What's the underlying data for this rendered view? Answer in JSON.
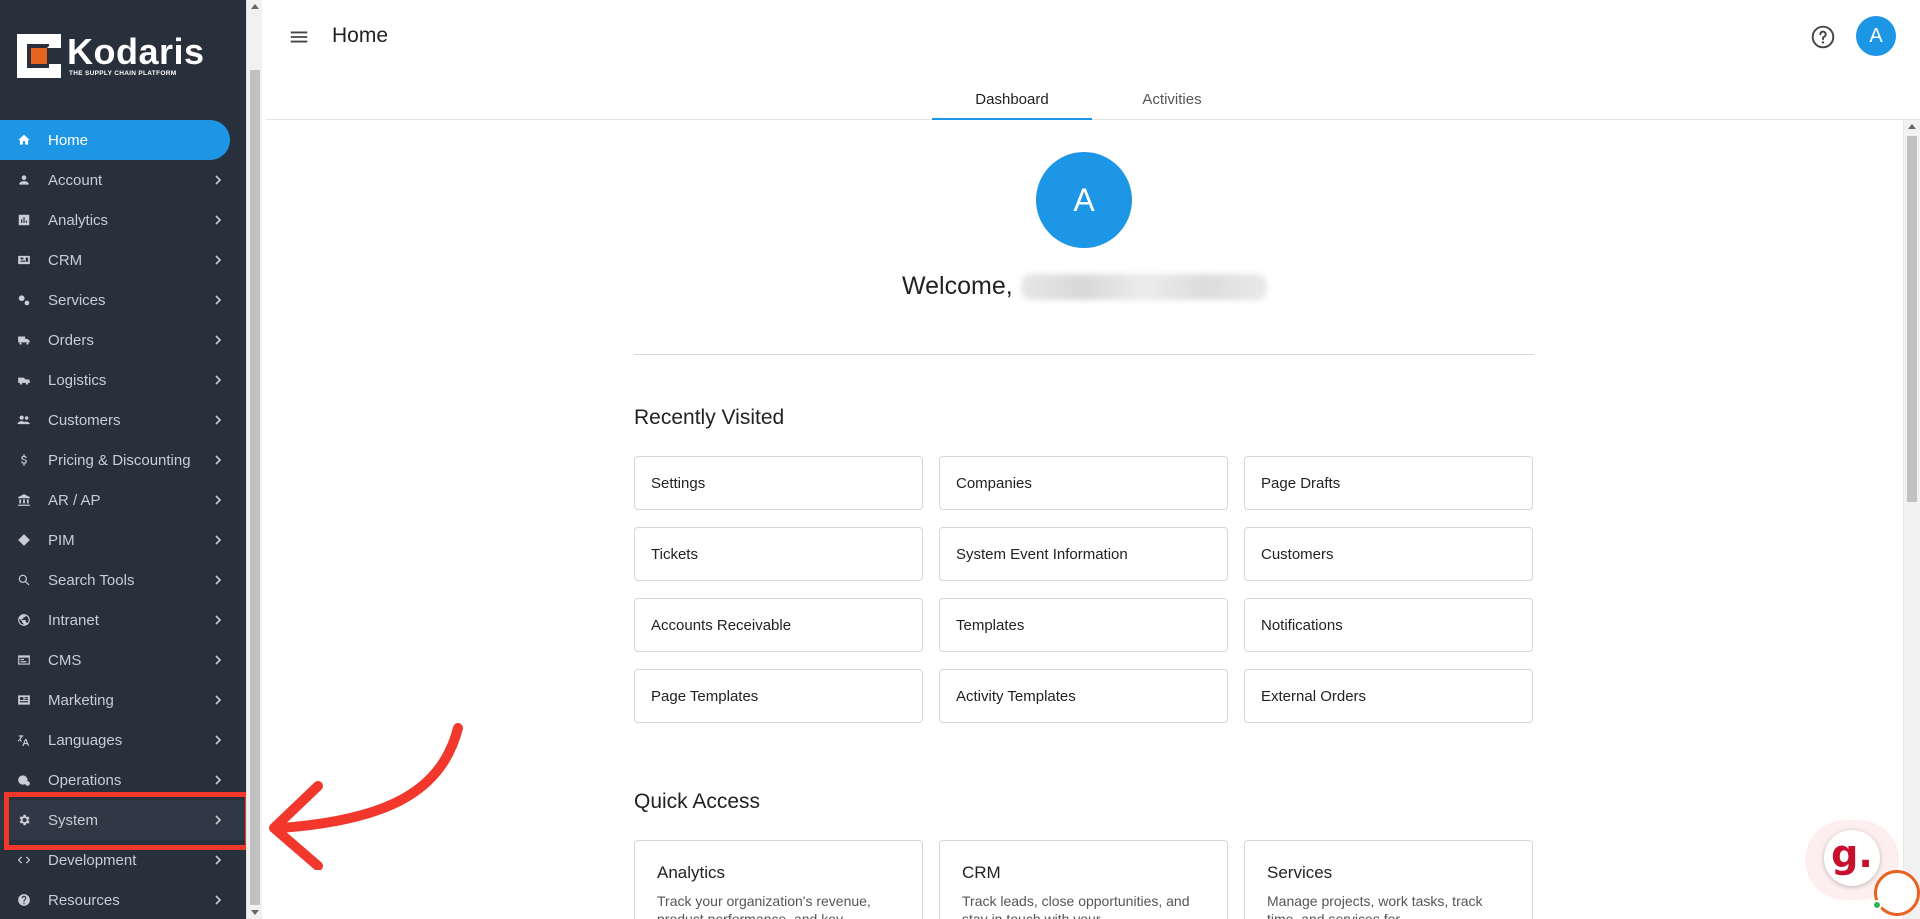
{
  "app": {
    "logo_name": "Kodaris",
    "logo_tagline": "THE SUPPLY CHAIN PLATFORM"
  },
  "sidebar": {
    "items": [
      {
        "label": "Home",
        "icon": "home-icon",
        "active": true
      },
      {
        "label": "Account",
        "icon": "person-icon"
      },
      {
        "label": "Analytics",
        "icon": "analytics-icon"
      },
      {
        "label": "CRM",
        "icon": "crm-icon"
      },
      {
        "label": "Services",
        "icon": "gears-icon"
      },
      {
        "label": "Orders",
        "icon": "truck-icon"
      },
      {
        "label": "Logistics",
        "icon": "shipping-icon"
      },
      {
        "label": "Customers",
        "icon": "people-icon"
      },
      {
        "label": "Pricing & Discounting",
        "icon": "dollar-icon"
      },
      {
        "label": "AR / AP",
        "icon": "bank-icon"
      },
      {
        "label": "PIM",
        "icon": "tag-icon"
      },
      {
        "label": "Search Tools",
        "icon": "search-icon"
      },
      {
        "label": "Intranet",
        "icon": "globe-icon"
      },
      {
        "label": "CMS",
        "icon": "cms-icon"
      },
      {
        "label": "Marketing",
        "icon": "newspaper-icon"
      },
      {
        "label": "Languages",
        "icon": "translate-icon"
      },
      {
        "label": "Operations",
        "icon": "operations-icon"
      },
      {
        "label": "System",
        "icon": "gear-icon",
        "highlighted": true
      },
      {
        "label": "Development",
        "icon": "code-icon"
      },
      {
        "label": "Resources",
        "icon": "help-circle-icon"
      }
    ]
  },
  "header": {
    "title": "Home",
    "avatar_letter": "A",
    "tabs": [
      {
        "label": "Dashboard",
        "active": true
      },
      {
        "label": "Activities",
        "active": false
      }
    ]
  },
  "main": {
    "avatar_letter": "A",
    "welcome": "Welcome,",
    "recently_visited": {
      "title": "Recently Visited",
      "items": [
        "Settings",
        "Companies",
        "Page Drafts",
        "Tickets",
        "System Event Information",
        "Customers",
        "Accounts Receivable",
        "Templates",
        "Notifications",
        "Page Templates",
        "Activity Templates",
        "External Orders"
      ]
    },
    "quick_access": {
      "title": "Quick Access",
      "items": [
        {
          "title": "Analytics",
          "desc": "Track your organization's revenue, product performance, and key"
        },
        {
          "title": "CRM",
          "desc": "Track leads, close opportunities, and stay in touch with your"
        },
        {
          "title": "Services",
          "desc": "Manage projects, work tasks, track time, and services for"
        }
      ]
    }
  },
  "widgets": {
    "g_badge": "g."
  },
  "colors": {
    "sidebar_bg": "#27303b",
    "accent": "#1e96e6",
    "highlight": "#f2382c"
  }
}
